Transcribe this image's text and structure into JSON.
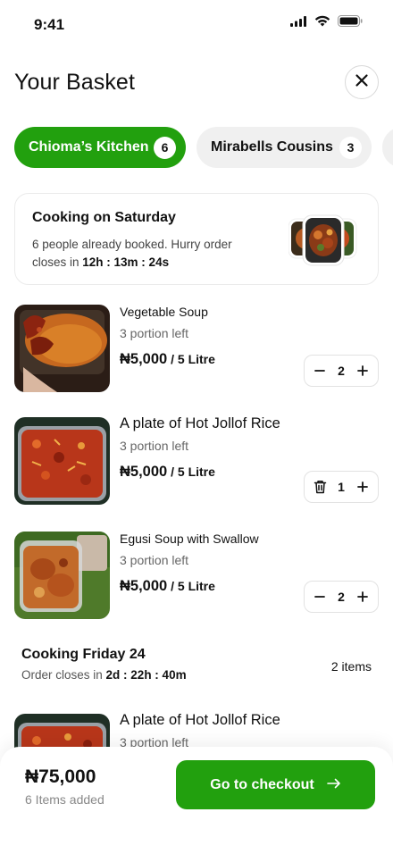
{
  "status_bar": {
    "time": "9:41"
  },
  "header": {
    "title": "Your Basket"
  },
  "tabs": [
    {
      "label": "Chioma’s Kitchen",
      "count": "6",
      "active": true
    },
    {
      "label": "Mirabells Cousins",
      "count": "3",
      "active": false
    }
  ],
  "promo": {
    "title": "Cooking on Saturday",
    "desc_prefix": "6 people already booked. Hurry order closes in ",
    "countdown": "12h : 13m : 24s"
  },
  "items": [
    {
      "name": "Vegetable Soup",
      "portion": "3 portion left",
      "price": "₦5,000",
      "unit": " / 5 Litre",
      "qty": "2",
      "minus_icon": "minus-icon"
    },
    {
      "name": "A plate of Hot Jollof Rice",
      "portion": "3 portion left",
      "price": "₦5,000",
      "unit": " / 5 Litre",
      "qty": "1",
      "minus_icon": "trash-icon"
    },
    {
      "name": "Egusi Soup with Swallow",
      "portion": "3 portion left",
      "price": "₦5,000",
      "unit": " / 5 Litre",
      "qty": "2",
      "minus_icon": "minus-icon"
    },
    {
      "name": "A plate of Hot Jollof Rice",
      "portion": "3 portion left"
    }
  ],
  "section2": {
    "title": "Cooking Friday 24",
    "desc_prefix": "Order closes in ",
    "countdown": "2d : 22h : 40m",
    "count": "2 items"
  },
  "footer": {
    "total": "₦75,000",
    "sub": "6 Items added",
    "checkout_label": "Go to checkout"
  },
  "colors": {
    "accent": "#22a00e",
    "tab_inactive_bg": "#f0f0f0"
  }
}
